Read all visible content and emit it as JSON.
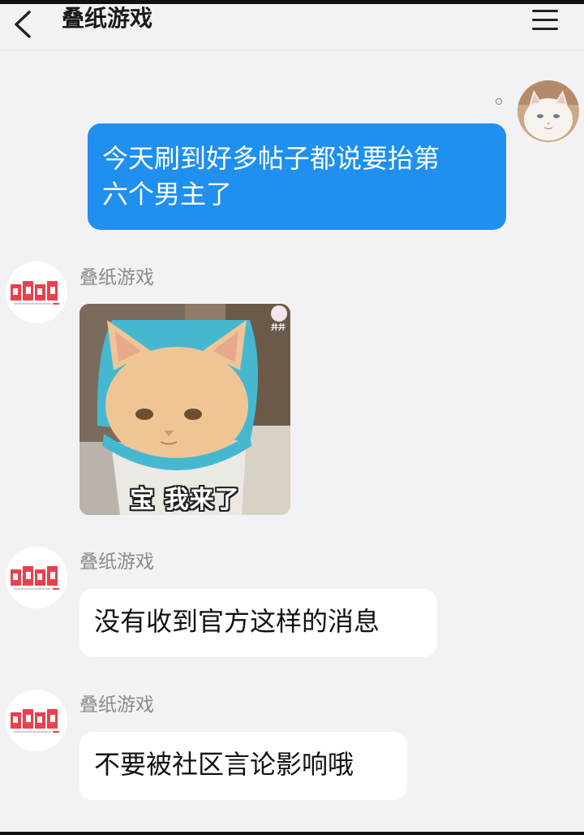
{
  "header": {
    "title": "叠纸游戏",
    "back_icon": "chevron-left-icon",
    "menu_icon": "hamburger-menu-icon"
  },
  "messages": [
    {
      "direction": "outgoing",
      "text_line1": "今天刷到好多帖子都说要抬第",
      "text_line2": "六个男主了",
      "avatar": "white-cat-avatar"
    },
    {
      "direction": "incoming",
      "sender": "叠纸游戏",
      "type": "sticker",
      "sticker_caption": "宝 我来了",
      "sticker_badge": "井井"
    },
    {
      "direction": "incoming",
      "sender": "叠纸游戏",
      "type": "text",
      "text": "没有收到官方这样的消息"
    },
    {
      "direction": "incoming",
      "sender": "叠纸游戏",
      "type": "text",
      "text": "不要被社区言论影响哦"
    }
  ],
  "colors": {
    "outgoing_bubble": "#1f8ff0",
    "incoming_bubble": "#ffffff",
    "background": "#f2f2f5",
    "logo_red": "#e8414d"
  }
}
